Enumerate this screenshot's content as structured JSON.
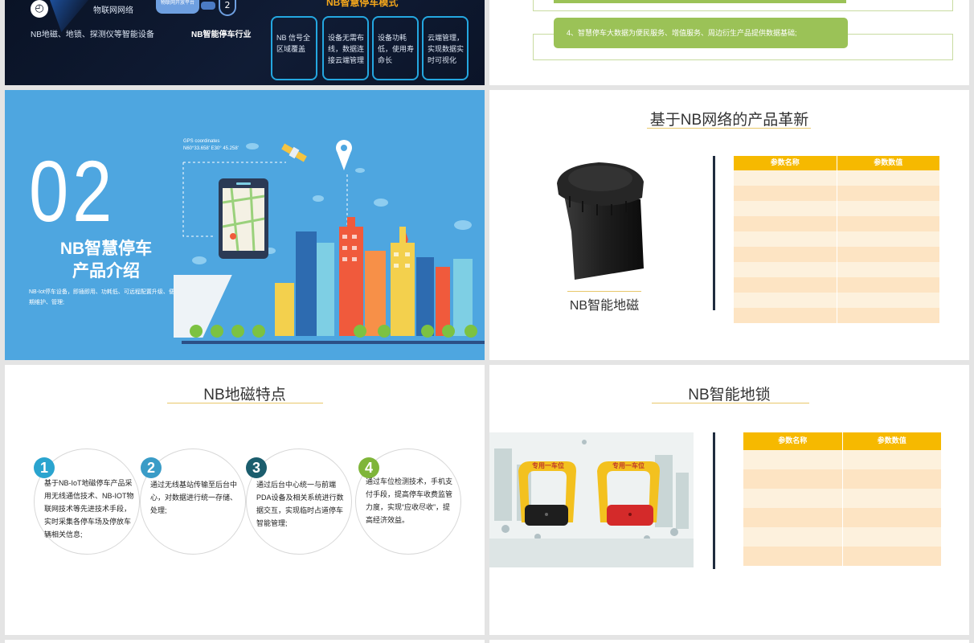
{
  "slide1": {
    "label_iot": "物联网网络",
    "label_devices": "NB地磁、地锁、探测仪等智能设备",
    "pill": "物联网开放平台",
    "label_industry": "NB智能停车行业",
    "mode_title": "NB智慧停车模式",
    "boxes": [
      "NB 信号全区域覆盖",
      "设备无需布线，数据连接云端管理",
      "设备功耗低，使用寿命长",
      "云端管理，实现数据实时可视化"
    ]
  },
  "slide2": {
    "item4": "4、智慧停车大数据为便民服务、增值服务、周边衍生产品提供数据基础;"
  },
  "slide3": {
    "number": "02",
    "title_line1": "NB智慧停车",
    "title_line2": "产品介绍",
    "desc": "NB-Iot停车设备，即插即用、功耗低、可远程配置升级、便于后期维护、管理;",
    "gps_label": "GPS coordinates",
    "gps_value": "N60°33.658' E30° 45.258'"
  },
  "slide4": {
    "title": "基于NB网络的产品革新",
    "product_caption": "NB智能地磁",
    "table_headers": [
      "参数名称",
      "参数数值"
    ]
  },
  "slide5": {
    "title": "NB地磁特点",
    "items": [
      {
        "num": "1",
        "text": "基于NB-IoT地磁停车产品采用无线通信技术、NB-IOT物联网技术等先进技术手段，实时采集各停车场及停放车辆相关信息;",
        "color": "#2aa4cf"
      },
      {
        "num": "2",
        "text": "通过无线基站传输至后台中心，对数据进行统一存储、处理;",
        "color": "#3a9cc7"
      },
      {
        "num": "3",
        "text": "通过后台中心统一与前端PDA设备及相关系统进行数据交互，实现临时占道停车智能管理;",
        "color": "#1b5d6d"
      },
      {
        "num": "4",
        "text": "通过车位检测技术，手机支付手段，提高停车收费监管力度，实现“应收尽收”，提高经济效益。",
        "color": "#7fb539"
      }
    ]
  },
  "slide6": {
    "title": "NB智能地锁",
    "lock_sign": "专用一车位",
    "table_headers": [
      "参数名称",
      "参数数值"
    ]
  }
}
